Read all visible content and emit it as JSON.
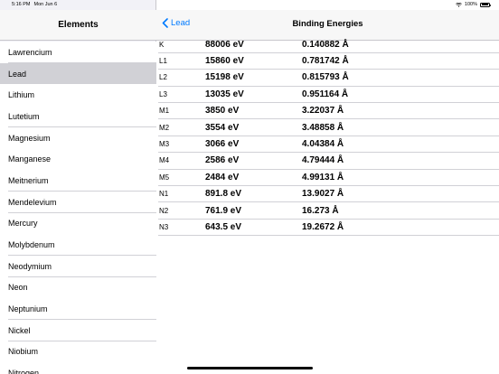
{
  "status_bar": {
    "time": "5:16 PM",
    "date": "Mon Jun 6",
    "battery_percent": "100%",
    "battery_level": 1.0
  },
  "sidebar": {
    "title": "Elements",
    "selected_index": 1,
    "items": [
      {
        "label": "Lawrencium"
      },
      {
        "label": "Lead"
      },
      {
        "label": "Lithium"
      },
      {
        "label": "Lutetium"
      },
      {
        "label": "Magnesium"
      },
      {
        "label": "Manganese"
      },
      {
        "label": "Meitnerium"
      },
      {
        "label": "Mendelevium"
      },
      {
        "label": "Mercury"
      },
      {
        "label": "Molybdenum"
      },
      {
        "label": "Neodymium"
      },
      {
        "label": "Neon"
      },
      {
        "label": "Neptunium"
      },
      {
        "label": "Nickel"
      },
      {
        "label": "Niobium"
      },
      {
        "label": "Nitrogen"
      }
    ]
  },
  "detail": {
    "back_label": "Lead",
    "title": "Binding Energies",
    "accent_color": "#007aff",
    "rows": [
      {
        "shell": "K",
        "energy": "88006 eV",
        "wavelength": "0.140882 Å"
      },
      {
        "shell": "L1",
        "energy": "15860 eV",
        "wavelength": "0.781742 Å"
      },
      {
        "shell": "L2",
        "energy": "15198 eV",
        "wavelength": "0.815793 Å"
      },
      {
        "shell": "L3",
        "energy": "13035 eV",
        "wavelength": "0.951164 Å"
      },
      {
        "shell": "M1",
        "energy": "3850 eV",
        "wavelength": "3.22037 Å"
      },
      {
        "shell": "M2",
        "energy": "3554 eV",
        "wavelength": "3.48858 Å"
      },
      {
        "shell": "M3",
        "energy": "3066 eV",
        "wavelength": "4.04384 Å"
      },
      {
        "shell": "M4",
        "energy": "2586 eV",
        "wavelength": "4.79444 Å"
      },
      {
        "shell": "M5",
        "energy": "2484 eV",
        "wavelength": "4.99131 Å"
      },
      {
        "shell": "N1",
        "energy": "891.8 eV",
        "wavelength": "13.9027 Å"
      },
      {
        "shell": "N2",
        "energy": "761.9 eV",
        "wavelength": "16.273 Å"
      },
      {
        "shell": "N3",
        "energy": "643.5 eV",
        "wavelength": "19.2672 Å"
      }
    ]
  }
}
